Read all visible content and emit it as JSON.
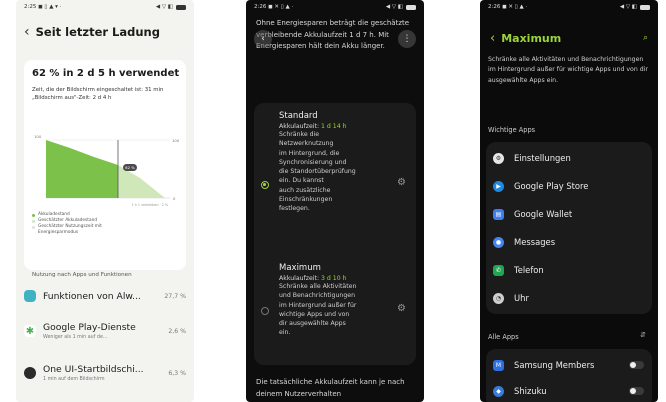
{
  "phone1": {
    "status": {
      "time": "2:25",
      "icons": "◼ ▯ ▲ ▾ ·",
      "right": "◀ ▽ ◧"
    },
    "title": "Seit letzter Ladung",
    "headline": "62 % in 2 d 5 h verwendet",
    "sub1": "Zeit, die der Bildschirm eingeschaltet ist: 31 min",
    "sub2": "„Bildschirm aus\"-Zeit: 2 d 4 h",
    "chart": {
      "ylabel_top": "100",
      "ylabel_bottom": "0",
      "tick_label": "62 %",
      "x_right": "1 h 1 verbleiben · 2 %"
    },
    "legend": [
      "Akkuladestand",
      "Geschätzter Akkuladestand",
      "Geschätzter Nutzungszeit mit Energiesparmodus"
    ],
    "section": "Nutzung nach Apps und Funktionen",
    "apps": [
      {
        "name": "Funktionen von Alw...",
        "desc": "",
        "pct": "27,7 %",
        "color": "#3fb3c2"
      },
      {
        "name": "Google Play-Dienste",
        "desc": "Weniger als 1 min auf de...",
        "pct": "2,6 %",
        "color": "#4caf50"
      },
      {
        "name": "One UI-Startbildschi...",
        "desc": "1 min auf dem Bildschirm",
        "pct": "6,3 %",
        "color": "#2b2b2b"
      }
    ]
  },
  "phone2": {
    "status": {
      "time": "2:26",
      "icons": "◼ ✕ ▯ ▲ ·",
      "right": "◀ ▽ ◧"
    },
    "intro": "Ohne Energiesparen beträgt die geschätzte verbleibende Akkulaufzeit 1 d 7 h. Mit Energiesparen hält dein Akku länger.",
    "options": [
      {
        "title": "Standard",
        "life_label": "Akkulaufzeit: ",
        "life_value": "1 d 14 h",
        "desc": [
          "Schränke die",
          "Netzwerknutzung",
          "im Hintergrund, die",
          "Synchronisierung und",
          "die Standortüberprüfung",
          "ein. Du kannst",
          "auch zusätzliche",
          "Einschränkungen",
          "festlegen."
        ]
      },
      {
        "title": "Maximum",
        "life_label": "Akkulaufzeit: ",
        "life_value": "3 d 10 h",
        "desc": [
          "Schränke alle Aktivitäten",
          "und Benachrichtigungen",
          "im Hintergrund außer für",
          "wichtige Apps und von",
          "dir ausgewählte Apps",
          "ein."
        ]
      }
    ],
    "footer": "Die tatsächliche Akkulaufzeit kann je nach deinem Nutzerverhalten"
  },
  "phone3": {
    "status": {
      "time": "2:26",
      "icons": "◼ ✕ ▯ ▲ ·",
      "right": "◀ ▽ ◧"
    },
    "title": "Maximum",
    "desc": "Schränke alle Aktivitäten und Benachrichtigungen im Hintergrund außer für wichtige Apps und von dir ausgewählte Apps ein.",
    "section_important": "Wichtige Apps",
    "important_apps": [
      {
        "name": "Einstellungen",
        "color": "#e6e6e6",
        "glyph": "⚙"
      },
      {
        "name": "Google Play Store",
        "color": "#1e88e5",
        "glyph": "▶"
      },
      {
        "name": "Google Wallet",
        "color": "#3d7ef0",
        "glyph": "▤"
      },
      {
        "name": "Messages",
        "color": "#4285f4",
        "glyph": "●"
      },
      {
        "name": "Telefon",
        "color": "#1fa750",
        "glyph": "✆"
      },
      {
        "name": "Uhr",
        "color": "#cfcfcf",
        "glyph": "◔"
      }
    ],
    "section_all": "Alle Apps",
    "all_apps": [
      {
        "name": "Samsung Members",
        "color": "#2f6fe0",
        "glyph": "M"
      },
      {
        "name": "Shizuku",
        "color": "#3a7bd5",
        "glyph": "◆"
      }
    ]
  }
}
